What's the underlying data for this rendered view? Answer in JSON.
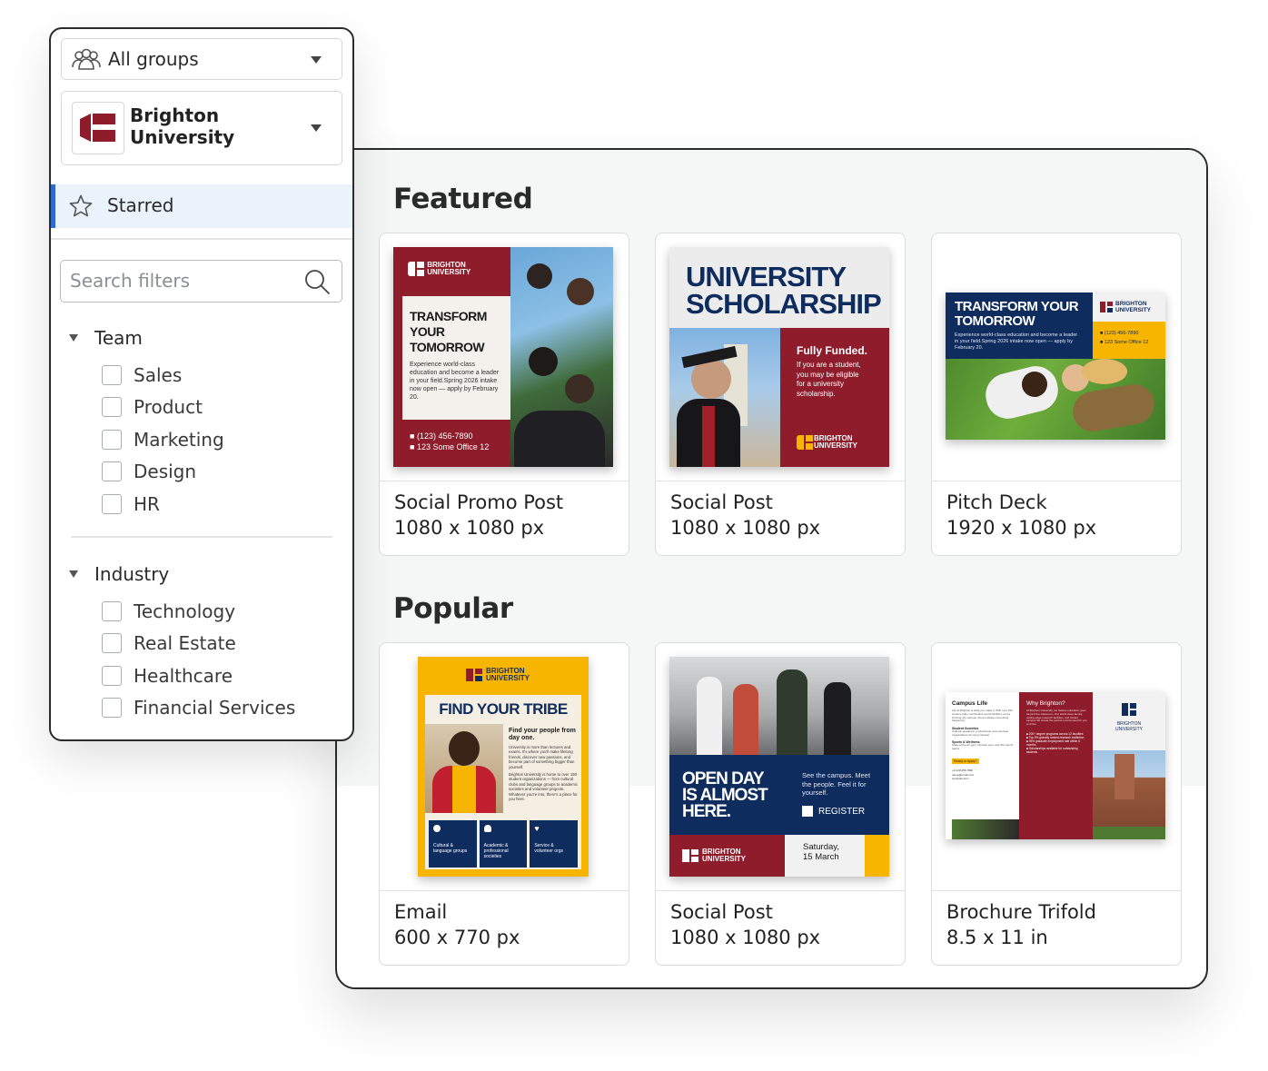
{
  "sidebar": {
    "groups_dropdown": {
      "label": "All groups"
    },
    "org_dropdown": {
      "line1": "Brighton",
      "line2": "University"
    },
    "starred_label": "Starred",
    "search": {
      "placeholder": "Search filters"
    },
    "filter_groups": [
      {
        "label": "Team",
        "options": [
          "Sales",
          "Product",
          "Marketing",
          "Design",
          "HR"
        ]
      },
      {
        "label": "Industry",
        "options": [
          "Technology",
          "Real Estate",
          "Healthcare",
          "Financial Services"
        ]
      }
    ]
  },
  "main": {
    "sections": [
      {
        "title": "Featured",
        "cards": [
          {
            "name": "Social Promo Post",
            "size": "1080 x 1080 px"
          },
          {
            "name": "Social Post",
            "size": "1080 x 1080 px"
          },
          {
            "name": "Pitch Deck",
            "size": "1920 x 1080 px"
          }
        ]
      },
      {
        "title": "Popular",
        "cards": [
          {
            "name": "Email",
            "size": "600 x 770 px"
          },
          {
            "name": "Social Post",
            "size": "1080 x 1080 px"
          },
          {
            "name": "Brochure Trifold",
            "size": "8.5 x 11 in"
          }
        ]
      }
    ]
  },
  "thumbnails": {
    "promo": {
      "brand": "BRIGHTON UNIVERSITY",
      "headline": [
        "TRANSFORM",
        "YOUR",
        "TOMORROW"
      ],
      "body": "Experience world-class education and become a leader in your field.Spring 2026 intake now open — apply by February 20.",
      "phone": "(123) 456-7890",
      "address": "123 Some Office 12"
    },
    "scholarship": {
      "headline": [
        "UNIVERSITY",
        "SCHOLARSHIP"
      ],
      "subhead": "Fully Funded.",
      "body": "If you are a student, you may be eligible for a university scholarship.",
      "brand": "BRIGHTON UNIVERSITY"
    },
    "pitch": {
      "headline": [
        "TRANSFORM YOUR",
        "TOMORROW"
      ],
      "body": "Experience world-class education and become a leader in your field.Spring 2026 intake now open — apply by February 20.",
      "brand": "BRIGHTON UNIVERSITY",
      "phone": "(123) 456-7890",
      "address": "123 Some Office 12"
    },
    "email": {
      "brand": "BRIGHTON UNIVERSITY",
      "headline": "FIND YOUR TRIBE",
      "subhead": "Find your people from day one.",
      "body1": "University is more than lectures and exams. It's where you'll make lifelong friends, discover new passions, and become part of something bigger than yourself.",
      "body2": "Brighton University is home to over 150 student organizations — from cultural clubs and language groups to academic societies and volunteer projects. Whatever you're into, there's a place for you here.",
      "features": [
        "Cultural & language groups",
        "Academic & professional societies",
        "Service & volunteer orgs"
      ]
    },
    "openday": {
      "headline": [
        "OPEN DAY",
        "IS ALMOST",
        "HERE."
      ],
      "body": "See the campus. Meet the people. Feel it for yourself.",
      "cta": "REGISTER",
      "brand": "BRIGHTON UNIVERSITY",
      "date": [
        "Saturday,",
        "15 March"
      ]
    },
    "brochure": {
      "panel1_title": "Campus Life",
      "panel1_body": "Life at Brighton is what you make it. With over 150 student clubs, world-class sports facilities, and a buzzing city campus, there's always something happening.",
      "panel1_items": [
        {
          "title": "Student Societies",
          "desc": "Cultural, academic, professional, and volunteer organizations for every interest."
        },
        {
          "title": "Sports & Wellness",
          "desc": "State-of-the-art gym, Olympic pool, and 40+ sports teams."
        }
      ],
      "panel1_cta": "Ready to Apply?",
      "panel1_contacts": [
        "+1(123)456-7890",
        "name@email.com",
        "somesite.com"
      ],
      "panel2_title": "Why Brighton?",
      "panel2_body": "At Brighton University, we believe education goes beyond the classroom. Our world-class faculty, cutting-edge research facilities, and vibrant campus life create the perfect environment for you to thrive.",
      "panel2_items": [
        "200+ degree programs across 12 faculties",
        "Top 5% globally ranked research institution",
        "95% graduate employment rate within 6 months",
        "Scholarships available for outstanding students"
      ],
      "brand": "BRIGHTON UNIVERSITY"
    }
  },
  "colors": {
    "brand_red": "#8e1c2b",
    "brand_navy": "#0f2c5e",
    "brand_yellow": "#f7b500",
    "accent_blue": "#2f6ad3"
  },
  "icons": [
    "people-icon",
    "brighton-logo-icon",
    "star-icon",
    "search-icon",
    "caret-down-icon",
    "triangle-down-icon"
  ]
}
